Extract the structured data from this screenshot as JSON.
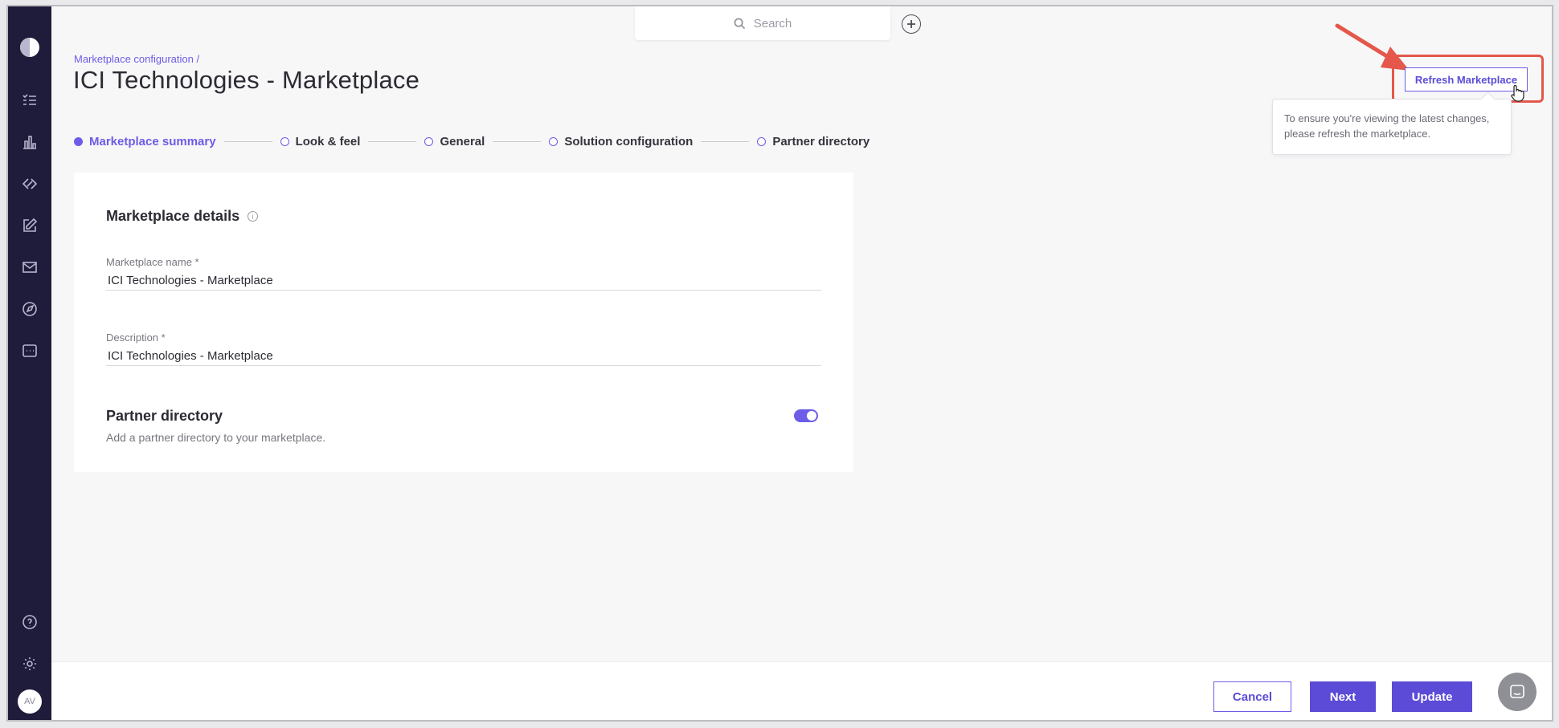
{
  "search": {
    "placeholder": "Search"
  },
  "header": {
    "breadcrumb": "Marketplace configuration /",
    "title": "ICI Technologies - Marketplace"
  },
  "refresh": {
    "button_label": "Refresh Marketplace",
    "tooltip_line1": "To ensure you're viewing the latest changes,",
    "tooltip_line2": "please refresh the marketplace."
  },
  "stepper": {
    "steps": [
      {
        "label": "Marketplace summary",
        "active": true
      },
      {
        "label": "Look & feel",
        "active": false
      },
      {
        "label": "General",
        "active": false
      },
      {
        "label": "Solution configuration",
        "active": false
      },
      {
        "label": "Partner directory",
        "active": false
      }
    ]
  },
  "details": {
    "title": "Marketplace details",
    "name_label": "Marketplace name *",
    "name_value": "ICI Technologies - Marketplace",
    "description_label": "Description *",
    "description_value": "ICI Technologies - Marketplace"
  },
  "partner_directory": {
    "title": "Partner directory",
    "description": "Add a partner directory to your marketplace.",
    "enabled": true
  },
  "user": {
    "initials": "AV"
  },
  "footer": {
    "cancel_label": "Cancel",
    "next_label": "Next",
    "update_label": "Update"
  },
  "colors": {
    "accent": "#6c5ce7",
    "sidebar": "#1f1b3a",
    "highlight": "#e4574a"
  }
}
